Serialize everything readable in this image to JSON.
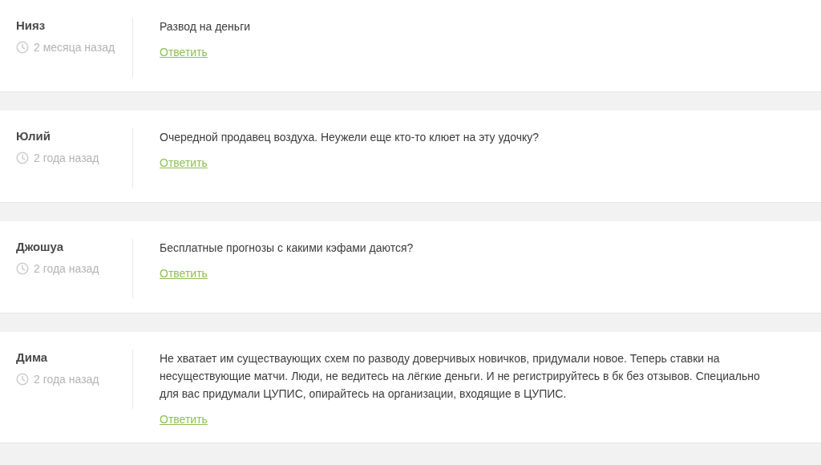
{
  "comments": [
    {
      "author": "Нияз",
      "time": "2 месяца назад",
      "text": "Развод на деньги",
      "reply": "Ответить"
    },
    {
      "author": "Юлий",
      "time": "2 года назад",
      "text": "Очередной продавец воздуха. Неужели еще кто-то клюет на эту удочку?",
      "reply": "Ответить"
    },
    {
      "author": "Джошуа",
      "time": "2 года назад",
      "text": "Бесплатные прогнозы с какими кэфами даются?",
      "reply": "Ответить"
    },
    {
      "author": "Дима",
      "time": "2 года назад",
      "text": "Не хватает им существаующих схем по разводу доверчивых новичков, придумали новое. Теперь ставки на несуществующие матчи. Люди, не ведитесь на лёгкие деньги. И не регистрируйтесь в бк без отзывов. Специально для вас придумали ЦУПИС, опирайтесь на организации, входящие в ЦУПИС.",
      "reply": "Ответить"
    }
  ]
}
